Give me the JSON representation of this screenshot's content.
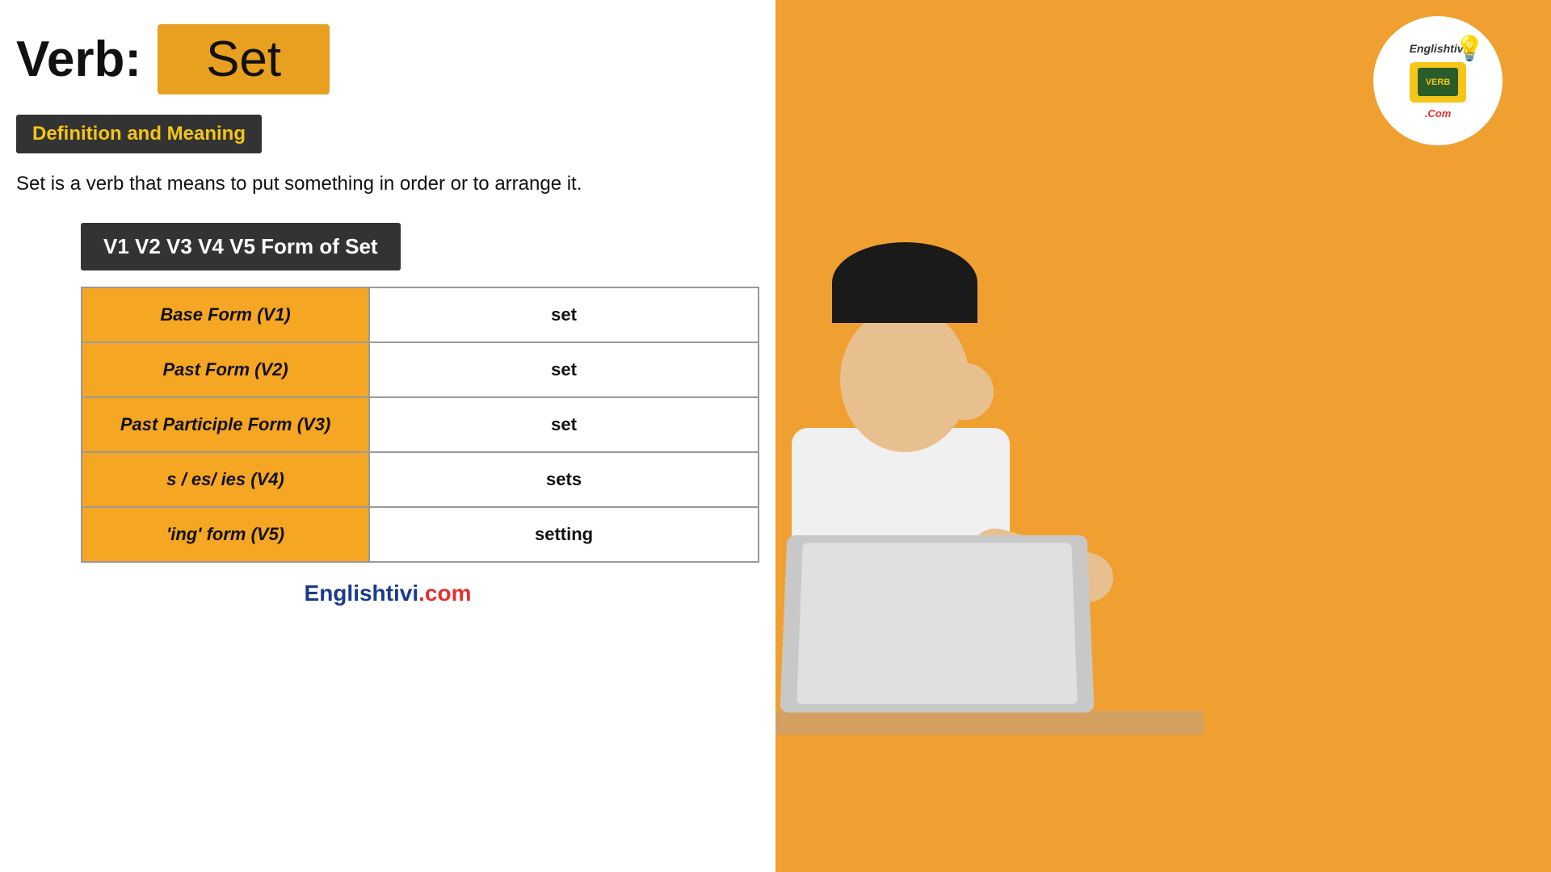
{
  "header": {
    "verb_label": "Verb:",
    "verb_word": "Set"
  },
  "definition_section": {
    "heading": "Definition and Meaning",
    "text": "Set is a verb that means to put something in order or to arrange it."
  },
  "v_forms_section": {
    "heading": "V1 V2 V3 V4 V5 Form of Set",
    "table_rows": [
      {
        "label": "Base Form (V1)",
        "value": "set"
      },
      {
        "label": "Past Form (V2)",
        "value": "set"
      },
      {
        "label": "Past Participle Form (V3)",
        "value": "set"
      },
      {
        "label": "s / es/ ies (V4)",
        "value": "sets"
      },
      {
        "label": "'ing' form (V5)",
        "value": "setting"
      }
    ]
  },
  "footer": {
    "brand_blue": "Englishtivi",
    "brand_red": ".com"
  },
  "logo": {
    "text_top": "Englishtivi.Com",
    "tv_screen_text": "VERB",
    "text_bottom": ".Com"
  }
}
